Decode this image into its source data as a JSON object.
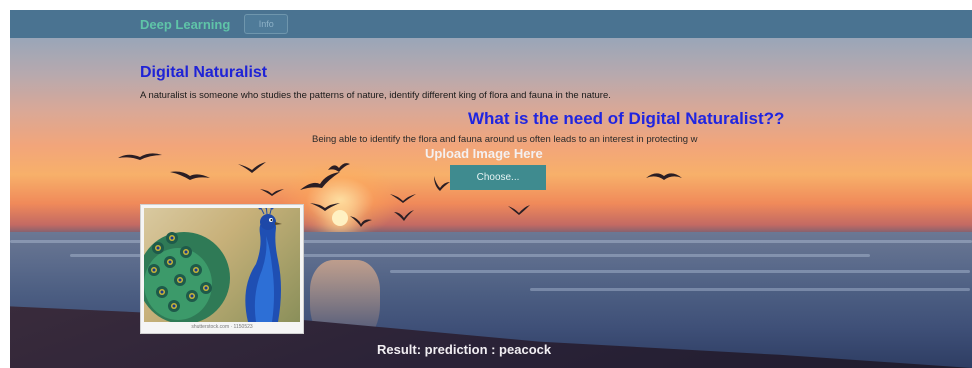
{
  "navbar": {
    "brand": "Deep Learning",
    "button_label": "Info"
  },
  "main": {
    "title": "Digital Naturalist",
    "intro": "A naturalist is someone who studies the patterns of nature, identify different king of flora and fauna in the nature.",
    "need_title": "What is the need of Digital Naturalist??",
    "need_text": "Being able to identify the flora and fauna around us often leads to an interest in protecting w",
    "upload_label": "Upload Image Here",
    "choose_button": "Choose..."
  },
  "preview": {
    "subject": "peacock",
    "caption": "shutterstock.com · 1150523"
  },
  "result": {
    "text": "Result: prediction : peacock"
  },
  "colors": {
    "navbar": "#4a7391",
    "brand": "#5fc4a8",
    "heading": "#1f23d6",
    "button": "#3f8b8f"
  },
  "icons": {
    "birds": "bird-silhouette-icon"
  }
}
